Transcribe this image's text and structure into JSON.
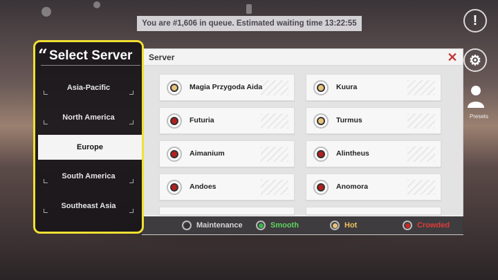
{
  "queue": {
    "text": "You are #1,606 in queue. Estimated waiting time 13:22:55"
  },
  "region_panel": {
    "title": "Select Server",
    "quote": "“",
    "regions": [
      {
        "label": "Asia-Pacific",
        "selected": false
      },
      {
        "label": "North America",
        "selected": false
      },
      {
        "label": "Europe",
        "selected": true
      },
      {
        "label": "South America",
        "selected": false
      },
      {
        "label": "Southeast Asia",
        "selected": false
      }
    ]
  },
  "server_panel": {
    "title": "Server",
    "close_glyph": "✕",
    "servers": [
      {
        "name": "Magia Przygoda Aida",
        "status": "hot"
      },
      {
        "name": "Kuura",
        "status": "hot"
      },
      {
        "name": "Futuria",
        "status": "crowded"
      },
      {
        "name": "Turmus",
        "status": "hot"
      },
      {
        "name": "Aimanium",
        "status": "crowded"
      },
      {
        "name": "Alintheus",
        "status": "crowded"
      },
      {
        "name": "Andoes",
        "status": "crowded"
      },
      {
        "name": "Anomora",
        "status": "crowded"
      }
    ]
  },
  "legend": [
    {
      "label": "Maintenance",
      "color": "#d8d8d8",
      "dot": "#333333"
    },
    {
      "label": "Smooth",
      "color": "#5fd35f",
      "dot": "#3bb54a"
    },
    {
      "label": "Hot",
      "color": "#f0c060",
      "dot": "#e8c27a"
    },
    {
      "label": "Crowded",
      "color": "#e03a3a",
      "dot": "#c62828"
    }
  ],
  "status_colors": {
    "hot": "#e8c27a",
    "crowded": "#b51f1f",
    "smooth": "#3bb54a",
    "maintenance": "#333333"
  },
  "right_icons": {
    "notice_glyph": "!",
    "settings_glyph": "⚙",
    "presets_label": "Presets"
  }
}
